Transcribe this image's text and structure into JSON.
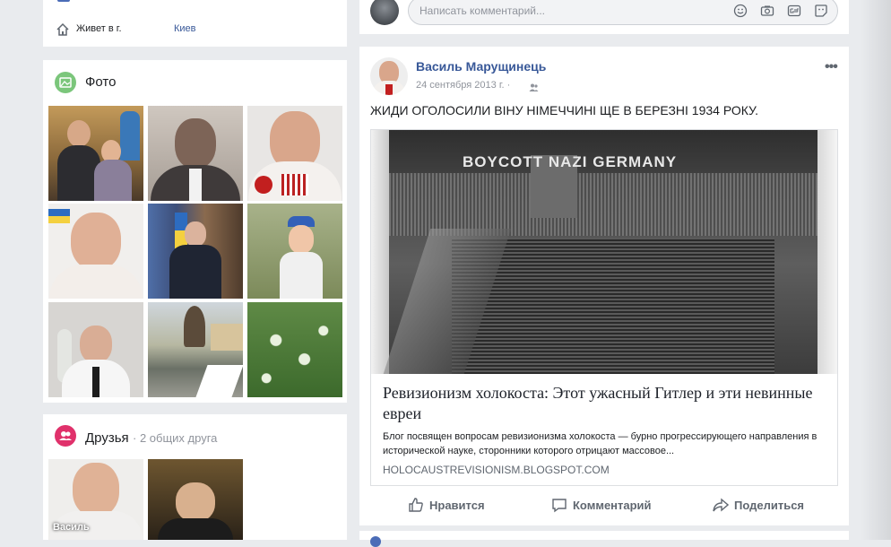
{
  "profile_intro": {
    "lives_label": "Живет в г.",
    "city": "Киев"
  },
  "photos": {
    "title": "Фото"
  },
  "friends": {
    "title": "Друзья",
    "mutual": " · 2 общих друга",
    "items": [
      {
        "name": "Василь"
      },
      {
        "name": ""
      }
    ]
  },
  "comment_box": {
    "placeholder": "Написать комментарий..."
  },
  "post": {
    "author": "Василь Марущинець",
    "date": "24 сентября 2013 г. ·",
    "text": "ЖИДИ ОГОЛОСИЛИ ВІНУ НІМЕЧЧИНІ ЩЕ В БЕРЕЗНІ 1934 РОКУ.",
    "image_banner": "BOYCOTT NAZI GERMANY",
    "link": {
      "title": "Ревизионизм холокоста: Этот ужасный Гитлер и эти невинные евреи",
      "description": "Блог посвящен вопросам ревизионизма холокоста — бурно прогрессирующего направления в исторической науке, сторонники которого отрицают массовое...",
      "domain": "HOLOCAUSTREVISIONISM.BLOGSPOT.COM"
    },
    "actions": {
      "like": "Нравится",
      "comment": "Комментарий",
      "share": "Поделиться"
    }
  },
  "colors": {
    "background": "#e9ebee",
    "link": "#385898",
    "photos_icon": "#7bc67b",
    "friends_icon": "#e0316b"
  }
}
